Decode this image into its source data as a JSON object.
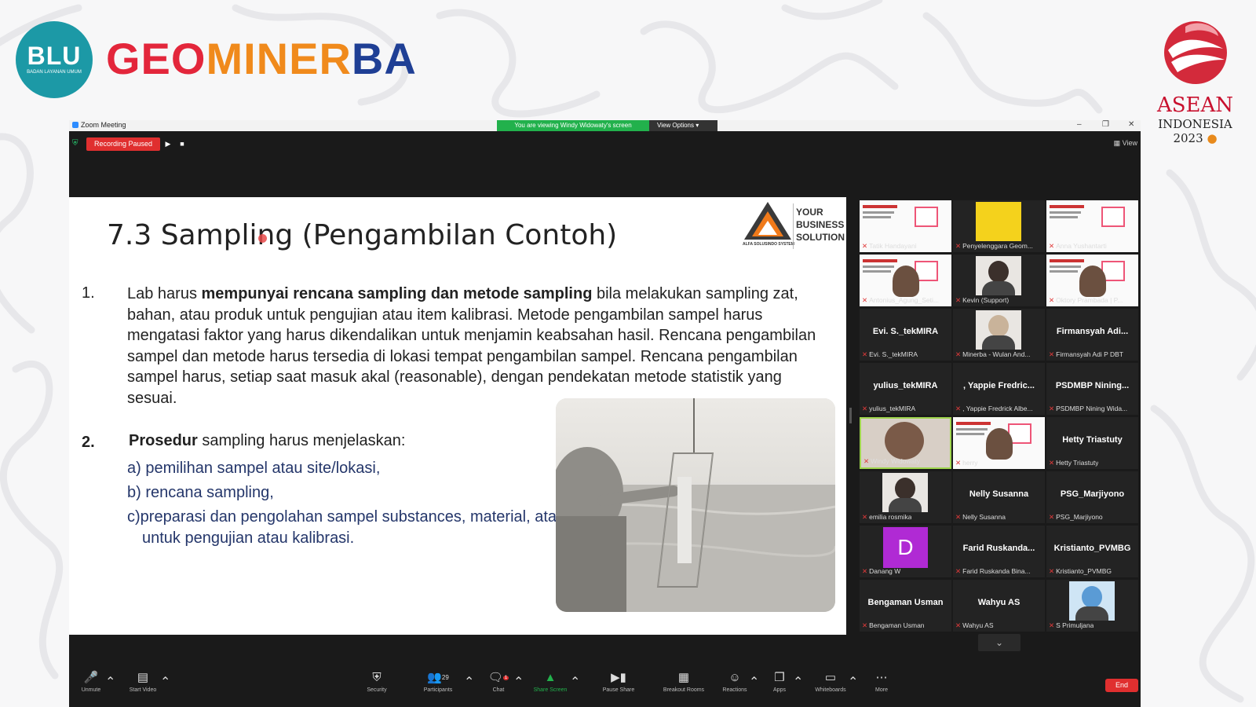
{
  "branding": {
    "blu_logo_text": "BLU",
    "blu_logo_subtitle": "BADAN LAYANAN UMUM",
    "brand_part1": "GEO",
    "brand_part2": "MINER",
    "brand_part3": "BA",
    "asean_line1": "ASEAN",
    "asean_line2": "INDONESIA",
    "asean_line3": "2023"
  },
  "zoom": {
    "window_title": "Zoom Meeting",
    "viewing_banner": "You are viewing Windy Widowaty's screen",
    "view_options": "View Options",
    "recording_status": "Recording Paused",
    "view_button": "View"
  },
  "slide": {
    "title": "7.3  Sampling (Pengambilan Contoh)",
    "logo_company": "ALFA SOLUSINDO SYSTEM",
    "logo_line1": "YOUR",
    "logo_line2": "BUSINESS",
    "logo_line3": "SOLUTION",
    "item1_number": "1.",
    "item1_lead": "Lab harus ",
    "item1_bold": "mempunyai rencana sampling dan metode sampling",
    "item1_rest": " bila melakukan sampling zat, bahan, atau produk untuk pengujian atau item kalibrasi. Metode pengambilan sampel harus mengatasi faktor yang harus dikendalikan untuk menjamin keabsahan hasil. Rencana pengambilan sampel dan metode harus tersedia di lokasi tempat pengambilan sampel. Rencana pengambilan sampel harus, setiap saat masuk akal (reasonable), dengan pendekatan metode statistik yang sesuai.",
    "item2_number": "2.",
    "item2_bold": "Prosedur",
    "item2_rest": " sampling harus menjelaskan:",
    "sub_a": "a) pemilihan sampel  atau site/lokasi,",
    "sub_b": "b) rencana sampling,",
    "sub_c1": "c)preparasi dan pengolahan sampel substances, material, atau produk yang diperlukan",
    "sub_c2": "untuk pengujian atau kalibrasi."
  },
  "participants": [
    {
      "label": "Tatik Handayani",
      "name": "",
      "kind": "slide"
    },
    {
      "label": "Penyelenggara Geom...",
      "name": "",
      "kind": "yellow"
    },
    {
      "label": "Anna Yushantarti",
      "name": "",
      "kind": "slide"
    },
    {
      "label": "Antonius_Agung_Seti...",
      "name": "",
      "kind": "slide-person"
    },
    {
      "label": "Kevin (Support)",
      "name": "",
      "kind": "person"
    },
    {
      "label": "Oktory Prambada | P...",
      "name": "",
      "kind": "slide-person"
    },
    {
      "label": "Evi. S._tekMIRA",
      "name": "Evi. S._tekMIRA",
      "kind": "text"
    },
    {
      "label": "Minerba - Wulan And...",
      "name": "",
      "kind": "hijab"
    },
    {
      "label": "Firmansyah Adi P DBT",
      "name": "Firmansyah  Adi...",
      "kind": "text"
    },
    {
      "label": "yulius_tekMIRA",
      "name": "yulius_tekMIRA",
      "kind": "text"
    },
    {
      "label": ", Yappie Fredrick Albe...",
      "name": ", Yappie  Fredric...",
      "kind": "text"
    },
    {
      "label": "PSDMBP Nining Wida...",
      "name": "PSDMBP  Nining...",
      "kind": "text"
    },
    {
      "label": "Windy Widowaty",
      "name": "",
      "kind": "webcam",
      "active": true
    },
    {
      "label": "herry",
      "name": "",
      "kind": "slide-person"
    },
    {
      "label": "Hetty Triastuty",
      "name": "Hetty Triastuty",
      "kind": "text"
    },
    {
      "label": "emilia rosmika",
      "name": "",
      "kind": "portrait"
    },
    {
      "label": "Nelly Susanna",
      "name": "Nelly Susanna",
      "kind": "text"
    },
    {
      "label": "PSG_Marjiyono",
      "name": "PSG_Marjiyono",
      "kind": "text"
    },
    {
      "label": "Danang W",
      "name": "",
      "kind": "avatar",
      "avatar_letter": "D"
    },
    {
      "label": "Farid Ruskanda Bina...",
      "name": "Farid  Ruskanda...",
      "kind": "text"
    },
    {
      "label": "Kristianto_PVMBG",
      "name": "Kristianto_PVMBG",
      "kind": "text"
    },
    {
      "label": "Bengaman Usman",
      "name": "Bengaman Usman",
      "kind": "text"
    },
    {
      "label": "Wahyu AS",
      "name": "Wahyu AS",
      "kind": "text"
    },
    {
      "label": "S Primuljana",
      "name": "",
      "kind": "cartoon"
    }
  ],
  "toolbar": {
    "unmute": "Unmute",
    "start_video": "Start Video",
    "security": "Security",
    "participants": "Participants",
    "participants_count": "29",
    "chat": "Chat",
    "chat_badge": "1",
    "share_screen": "Share Screen",
    "pause_share": "Pause Share",
    "breakout_rooms": "Breakout Rooms",
    "reactions": "Reactions",
    "apps": "Apps",
    "whiteboards": "Whiteboards",
    "more": "More",
    "end": "End"
  },
  "colors": {
    "brand_red": "#e3263b",
    "brand_orange": "#f08a1c",
    "brand_blue": "#1f3f95",
    "blu_teal": "#1c99a6",
    "zoom_green": "#22b14c",
    "recording_red": "#e02f2f",
    "active_speaker": "#9fd54d"
  }
}
